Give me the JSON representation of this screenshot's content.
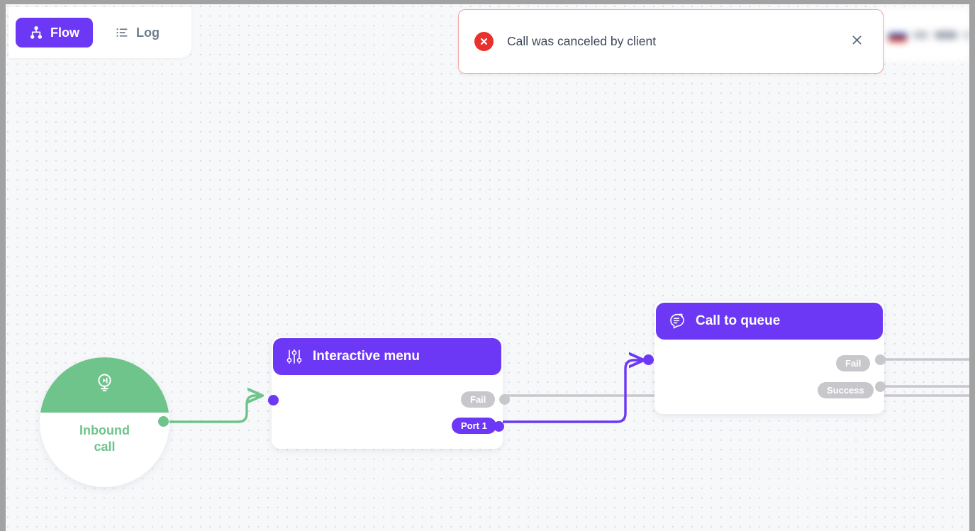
{
  "tabs": [
    {
      "label": "Flow",
      "icon": "flow-hierarchy-icon",
      "active": true
    },
    {
      "label": "Log",
      "icon": "list-log-icon",
      "active": false
    }
  ],
  "notification": {
    "message": "Call was canceled by client",
    "type": "error",
    "icon": "error-circle-x-icon",
    "close_icon": "close-x-icon",
    "accent_color": "#e8302c",
    "border_color": "#f2a7a7"
  },
  "topright": {
    "flag": "ru-flag-icon",
    "blurred": true
  },
  "canvas": {
    "background_color": "#f7f8fa",
    "dot_color": "#d6d9e0"
  },
  "colors": {
    "purple": "#6C38F5",
    "green": "#6ec48a",
    "gray_port": "#c8c8cc",
    "text_dark": "#3c4858",
    "text_muted": "#6d7b8d"
  },
  "nodes": [
    {
      "id": "inbound-call",
      "type": "start",
      "title": "Inbound\ncall",
      "title_line1": "Inbound",
      "title_line2": "call",
      "icon": "play-start-stand-icon",
      "color": "#6ec48a",
      "shape": "circle",
      "ports": [
        {
          "name": "out",
          "label": "",
          "color": "#6ec48a",
          "side": "right"
        }
      ]
    },
    {
      "id": "interactive-menu",
      "type": "ivr",
      "title": "Interactive menu",
      "icon": "sliders-tune-icon",
      "color": "#6C38F5",
      "ports": [
        {
          "name": "in",
          "label": "",
          "color": "#6C38F5",
          "side": "left"
        },
        {
          "name": "fail",
          "label": "Fail",
          "color": "#c8c8cc",
          "side": "right"
        },
        {
          "name": "port1",
          "label": "Port 1",
          "color": "#6C38F5",
          "side": "right"
        }
      ]
    },
    {
      "id": "call-to-queue",
      "type": "queue",
      "title": "Call to queue",
      "icon": "speech-bubble-list-icon",
      "color": "#6C38F5",
      "ports": [
        {
          "name": "in",
          "label": "",
          "color": "#6C38F5",
          "side": "left"
        },
        {
          "name": "fail",
          "label": "Fail",
          "color": "#c8c8cc",
          "side": "right"
        },
        {
          "name": "success",
          "label": "Success",
          "color": "#c8c8cc",
          "side": "right"
        }
      ]
    }
  ],
  "edges": [
    {
      "from": "inbound-call.out",
      "to": "interactive-menu.in",
      "color": "#6ec48a",
      "arrow": true
    },
    {
      "from": "interactive-menu.port1",
      "to": "call-to-queue.in",
      "color": "#6C38F5",
      "arrow": true
    },
    {
      "from": "interactive-menu.fail",
      "to": "",
      "color": "#c8c8cc",
      "arrow": false
    },
    {
      "from": "call-to-queue.fail",
      "to": "",
      "color": "#c8c8cc",
      "arrow": false
    },
    {
      "from": "call-to-queue.success",
      "to": "",
      "color": "#c8c8cc",
      "arrow": false
    }
  ]
}
